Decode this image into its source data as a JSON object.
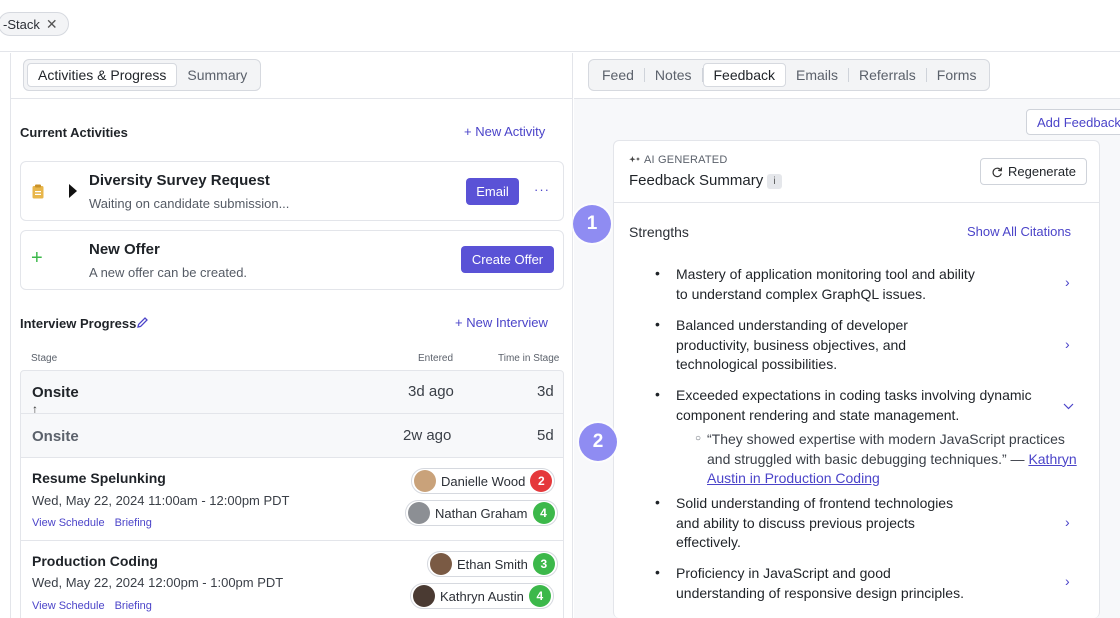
{
  "chip": {
    "label": "-Stack"
  },
  "left_tabs": [
    {
      "label": "Activities & Progress"
    },
    {
      "label": "Summary"
    }
  ],
  "right_tabs": [
    {
      "label": "Feed"
    },
    {
      "label": "Notes"
    },
    {
      "label": "Feedback"
    },
    {
      "label": "Emails"
    },
    {
      "label": "Referrals"
    },
    {
      "label": "Forms"
    }
  ],
  "current_activities": {
    "title": "Current Activities",
    "new_activity": "+ New Activity",
    "items": [
      {
        "title": "Diversity Survey Request",
        "subtitle": "Waiting on candidate submission...",
        "action": "Email",
        "more": "···"
      },
      {
        "title": "New Offer",
        "subtitle": "A new offer can be created.",
        "action": "Create Offer"
      }
    ]
  },
  "interview_progress": {
    "title": "Interview Progress",
    "new_interview": "+ New Interview",
    "headers": {
      "stage": "Stage",
      "entered": "Entered",
      "time": "Time in Stage"
    },
    "stages": [
      {
        "name": "Onsite",
        "entered": "3d ago",
        "time": "3d"
      },
      {
        "name": "Onsite",
        "entered": "2w ago",
        "time": "5d"
      }
    ],
    "interviews": [
      {
        "title": "Resume Spelunking",
        "time": "Wed, May 22, 2024 11:00am - 12:00pm PDT",
        "links": [
          "View Schedule",
          "Briefing"
        ],
        "people": [
          {
            "name": "Danielle Wood",
            "score": "2"
          },
          {
            "name": "Nathan Graham",
            "score": "4"
          }
        ]
      },
      {
        "title": "Production Coding",
        "time": "Wed, May 22, 2024 12:00pm - 1:00pm PDT",
        "links": [
          "View Schedule",
          "Briefing"
        ],
        "people": [
          {
            "name": "Ethan Smith",
            "score": "3"
          },
          {
            "name": "Kathryn Austin",
            "score": "4"
          }
        ]
      }
    ]
  },
  "feedback": {
    "add_button": "Add Feedback",
    "ai_label": "AI GENERATED",
    "title": "Feedback Summary",
    "info": "i",
    "regenerate": "Regenerate",
    "strengths_label": "Strengths",
    "show_citations": "Show All Citations",
    "strengths": [
      {
        "text": "Mastery of application monitoring tool and ability to understand complex GraphQL issues."
      },
      {
        "text": "Balanced understanding of developer productivity, business objectives, and technological possibilities."
      },
      {
        "text": "Exceeded expectations in coding tasks involving dynamic component rendering and state management.",
        "citation": "“They showed expertise with modern JavaScript practices and struggled with basic debugging techniques.” — ",
        "citation_link": "Kathryn Austin in Production Coding"
      },
      {
        "text": "Solid understanding of frontend technologies and ability to discuss previous projects effectively."
      },
      {
        "text": "Proficiency in JavaScript and good understanding of responsive design principles."
      }
    ]
  },
  "markers": [
    "1",
    "2"
  ],
  "colors": {
    "accent": "#5a52d6",
    "score_red": "#e5383b",
    "score_green": "#3cb84a",
    "marker": "#8f8cf2"
  }
}
